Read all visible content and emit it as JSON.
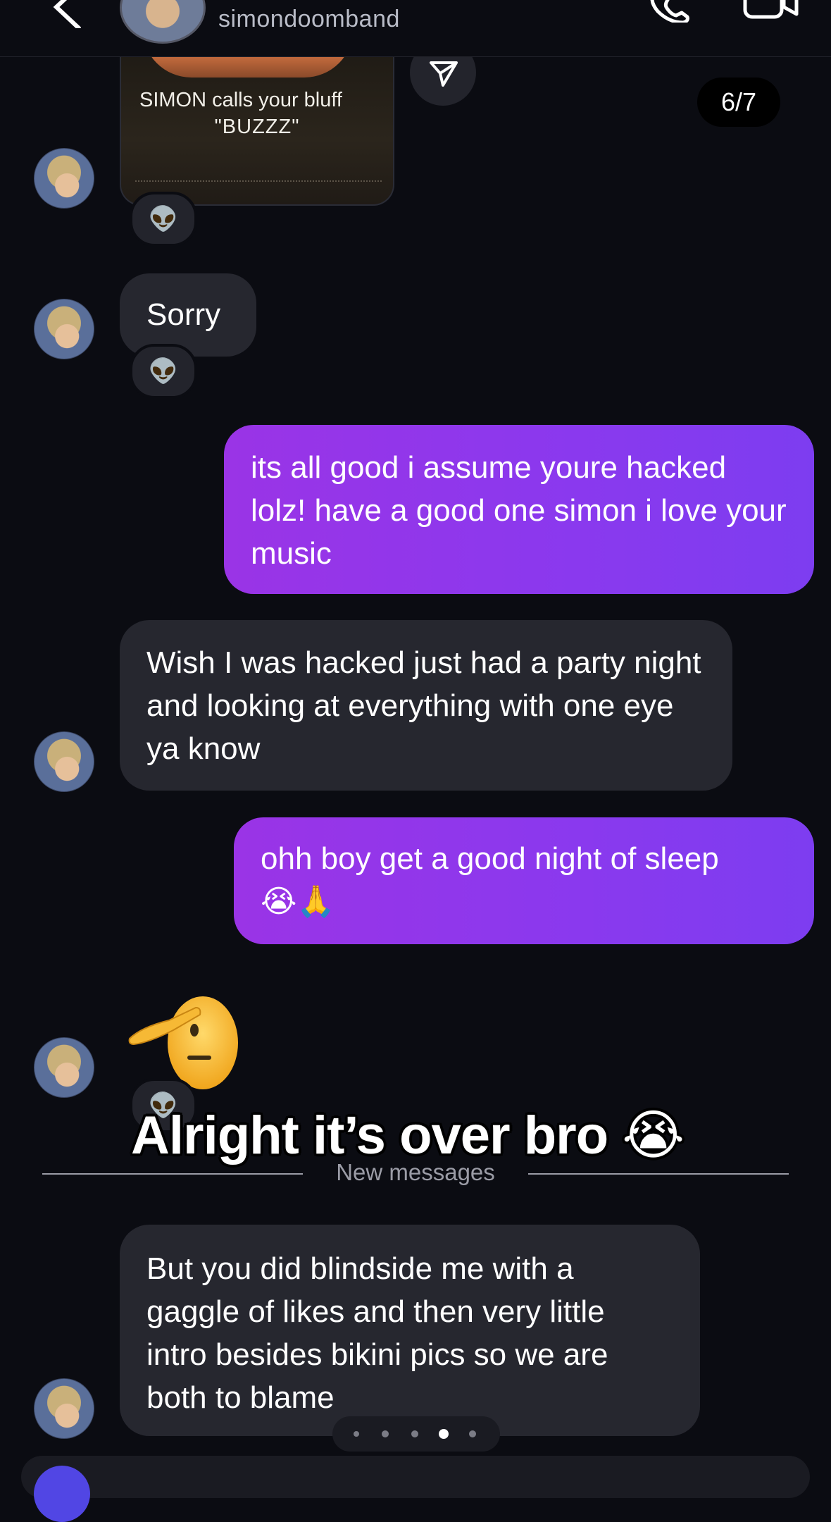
{
  "header": {
    "username": "simondoomband"
  },
  "image_message": {
    "caption_line1": "SIMON calls your bluff",
    "caption_line2": "\"BUZZZ\"",
    "reaction": "👽"
  },
  "slide_counter": "6/7",
  "messages": {
    "sorry": {
      "text": "Sorry",
      "reaction": "👽"
    },
    "out1": {
      "text": "its all good i assume youre hacked lolz! have a good one simon i love your music"
    },
    "in2": {
      "text": "Wish I was hacked just had a party night and looking at everything with one eye ya know"
    },
    "out2": {
      "line1": "ohh boy get a good night of sleep",
      "line2": "😭🙏"
    },
    "salute": {
      "reaction": "👽"
    },
    "in3": {
      "text": "But you did blindside me with a gaggle of likes and then very little intro besides bikini pics so we are both to blame"
    }
  },
  "overlay_caption": "Alright it’s over bro 😭",
  "divider_label": "New messages",
  "pager": {
    "count": 5,
    "active_index": 3
  },
  "colors": {
    "background": "#0b0c12",
    "incoming_bubble": "#26272f",
    "outgoing_bubble": "#8a39ee",
    "muted_text": "#9b9ca6"
  }
}
